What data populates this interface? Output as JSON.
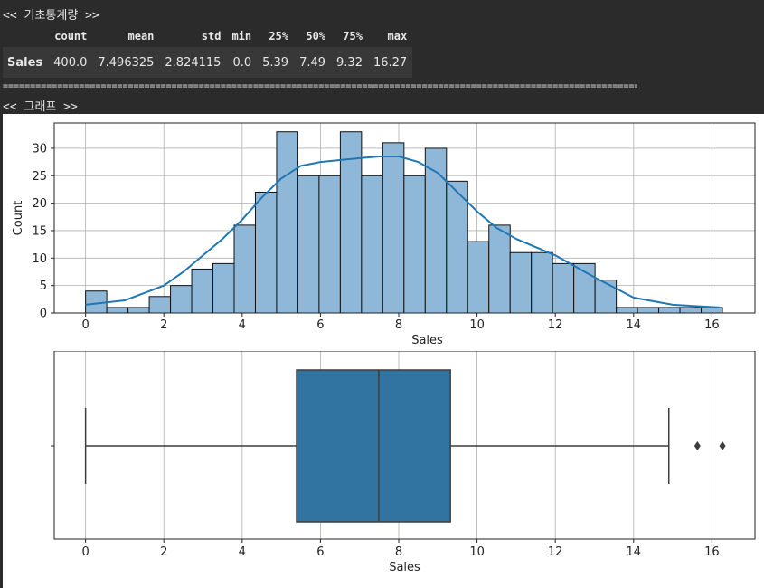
{
  "header_stats": "<< 기초통계량 >>",
  "stats_table": {
    "columns": [
      "count",
      "mean",
      "std",
      "min",
      "25%",
      "50%",
      "75%",
      "max"
    ],
    "row_label": "Sales",
    "values": [
      "400.0",
      "7.496325",
      "2.824115",
      "0.0",
      "5.39",
      "7.49",
      "9.32",
      "16.27"
    ]
  },
  "separator": "=================================================================================================================================================================================================",
  "header_graph": "<< 그래프 >>",
  "chart_data": [
    {
      "type": "histogram",
      "title": "",
      "xlabel": "Sales",
      "ylabel": "Count",
      "xlim": [
        -0.8,
        17.1
      ],
      "ylim": [
        0,
        34.6
      ],
      "xticks": [
        0,
        2,
        4,
        6,
        8,
        10,
        12,
        14,
        16
      ],
      "yticks": [
        0,
        5,
        10,
        15,
        20,
        25,
        30
      ],
      "grid": true,
      "bin_start": 0.0,
      "bin_width": 0.5423,
      "counts": [
        4,
        1,
        1,
        3,
        5,
        8,
        9,
        16,
        22,
        33,
        25,
        25,
        33,
        25,
        31,
        25,
        30,
        24,
        13,
        16,
        11,
        11,
        9,
        9,
        6,
        1,
        1,
        1,
        1,
        1
      ],
      "kde": {
        "x": [
          0,
          1,
          2,
          2.5,
          3,
          3.5,
          4,
          4.5,
          5,
          5.5,
          6,
          7,
          7.5,
          8,
          8.5,
          9,
          9.5,
          10,
          10.5,
          11,
          11.5,
          12,
          13,
          14,
          15,
          16.2
        ],
        "y": [
          1.5,
          2.3,
          5,
          7.5,
          10.5,
          13.5,
          17,
          21,
          24.5,
          26.8,
          27.5,
          28.2,
          28.5,
          28.5,
          27.5,
          25.5,
          22,
          18.5,
          15.5,
          13.5,
          12,
          10.5,
          6.5,
          2.8,
          1.5,
          1
        ]
      },
      "bar_color": "#8fb8d8",
      "line_color": "#1f77b4"
    },
    {
      "type": "boxplot",
      "title": "",
      "xlabel": "Sales",
      "xlim": [
        -0.8,
        17.1
      ],
      "xticks": [
        0,
        2,
        4,
        6,
        8,
        10,
        12,
        14,
        16
      ],
      "grid": true,
      "whisker_low": 0.0,
      "q1": 5.39,
      "median": 7.49,
      "q3": 9.32,
      "whisker_high": 14.9,
      "outliers": [
        15.63,
        16.27
      ],
      "box_color": "#3274a1"
    }
  ]
}
